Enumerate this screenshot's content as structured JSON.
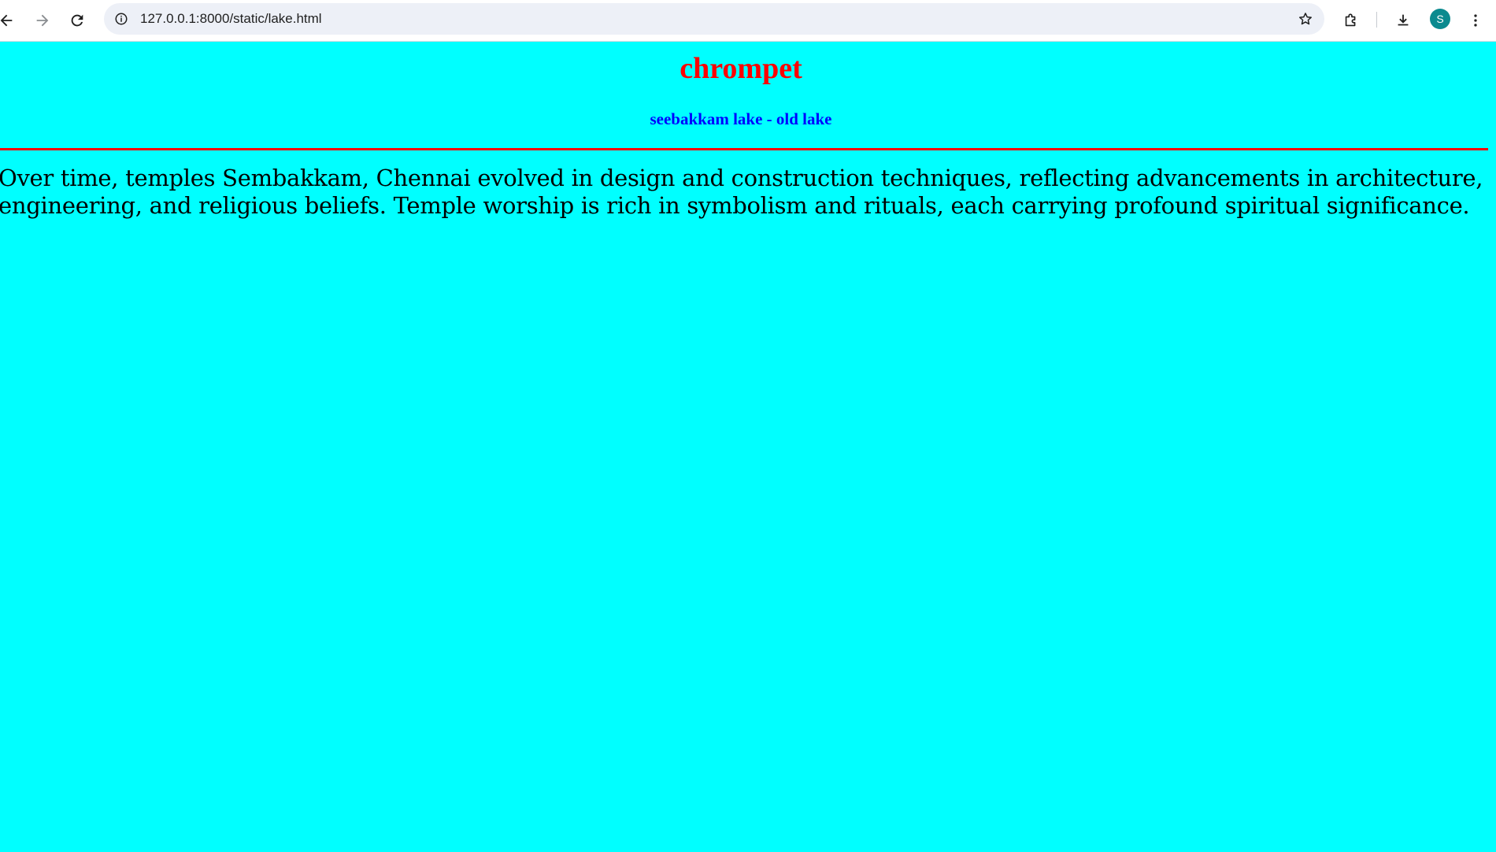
{
  "browser": {
    "url": "127.0.0.1:8000/static/lake.html",
    "profile_initial": "S",
    "icons": {
      "back": "back-arrow-icon",
      "forward": "forward-arrow-icon",
      "reload": "reload-icon",
      "site_info": "info-icon",
      "bookmark": "star-icon",
      "extensions": "extensions-icon",
      "downloads": "download-icon",
      "menu": "kebab-menu-icon"
    },
    "colors": {
      "avatar": "#0b8a8f",
      "omnibox": "#edf0f7"
    }
  },
  "page": {
    "heading": "chrompet",
    "subheading": "seebakkam lake - old lake",
    "paragraph": "Over time, temples Sembakkam, Chennai evolved in design and construction techniques, reflecting advancements in architecture, engineering, and religious beliefs. Temple worship is rich in symbolism and rituals, each carrying profound spiritual significance.",
    "colors": {
      "background": "#00ffff",
      "heading": "#ff0000",
      "subheading": "#0000ff",
      "rule": "#ff0000",
      "text": "#000000"
    }
  }
}
